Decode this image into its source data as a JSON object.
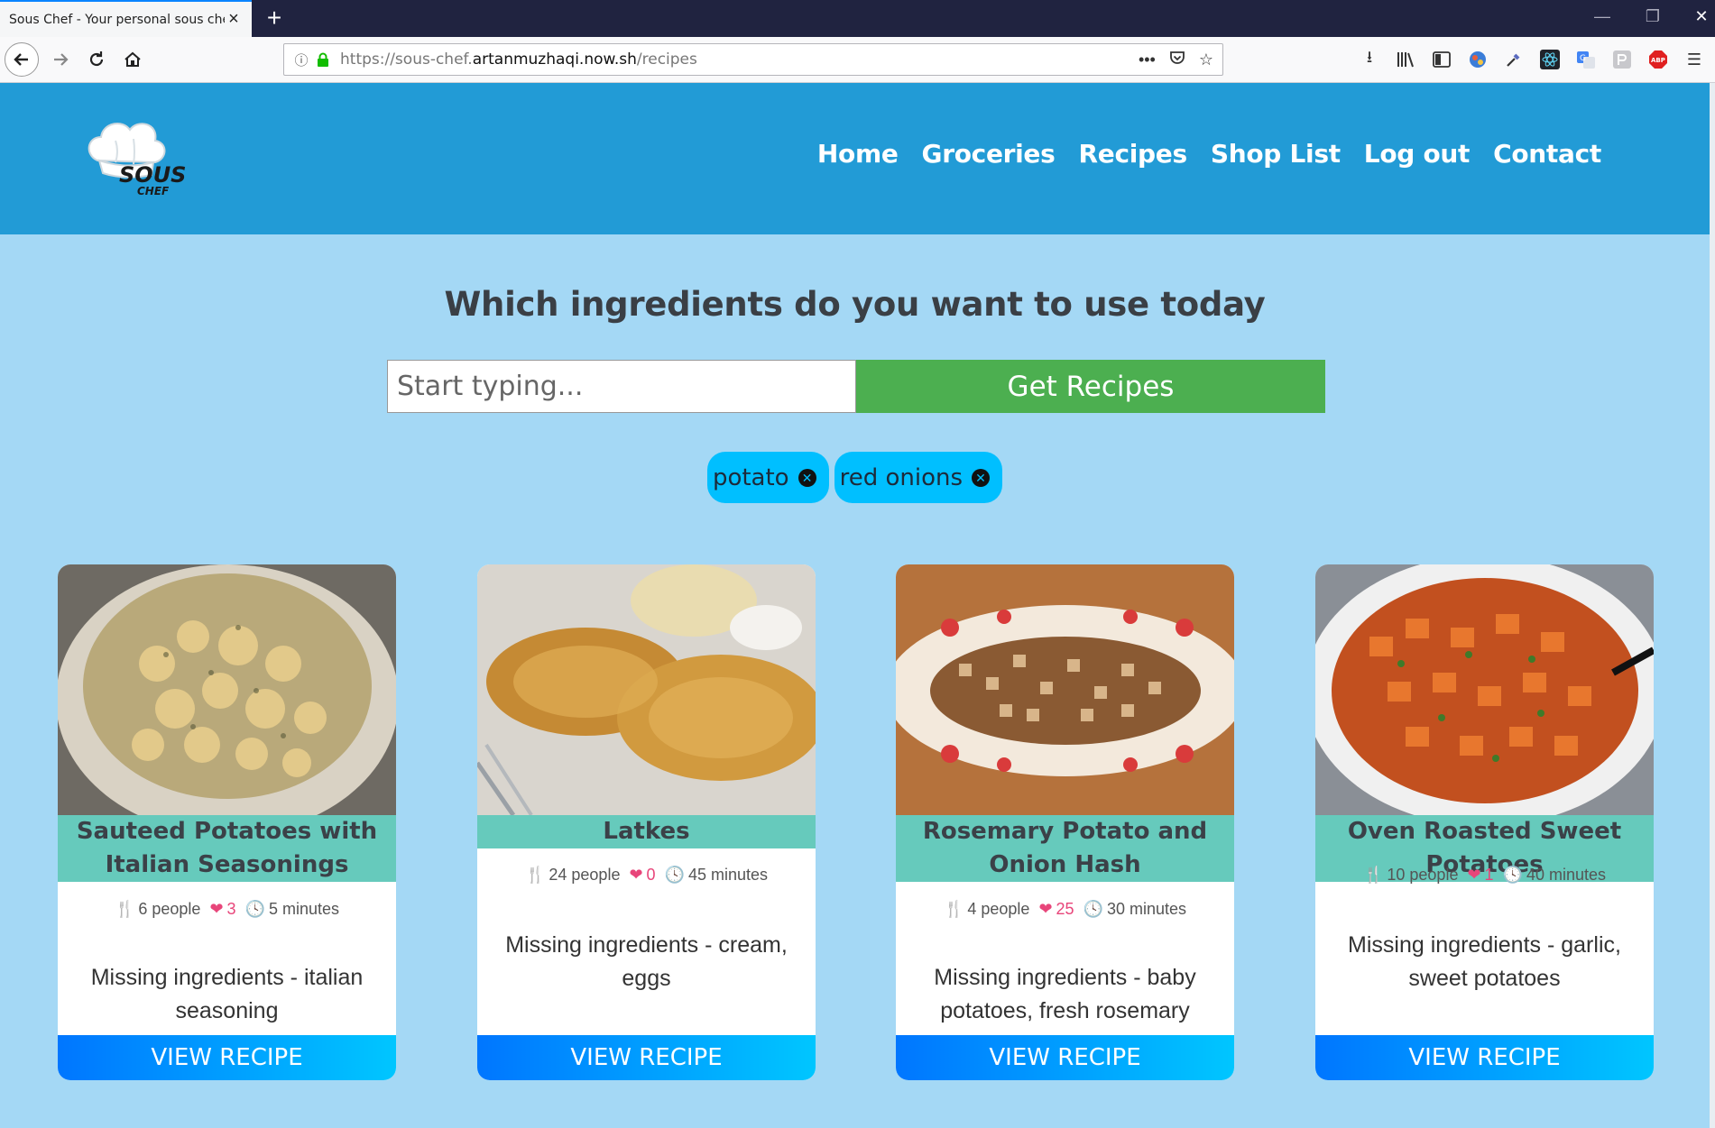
{
  "browser": {
    "tab_title": "Sous Chef - Your personal sous chef",
    "url_prefix": "https://sous-chef.",
    "url_domain": "artanmuzhaqi.now.sh",
    "url_path": "/recipes"
  },
  "site": {
    "logo_text": "SOUS",
    "logo_subtext": "CHEF",
    "nav": [
      "Home",
      "Groceries",
      "Recipes",
      "Shop List",
      "Log out",
      "Contact"
    ]
  },
  "search": {
    "heading": "Which ingredients do you want to use today",
    "placeholder": "Start typing...",
    "button_label": "Get Recipes",
    "chips": [
      "potato",
      "red onions"
    ]
  },
  "recipes": [
    {
      "title": "Sauteed Potatoes with Italian Seasonings",
      "people": "6 people",
      "likes": "3",
      "time": "5 minutes",
      "missing": "Missing ingredients - italian seasoning",
      "button": "VIEW RECIPE"
    },
    {
      "title": "Latkes",
      "people": "24 people",
      "likes": "0",
      "time": "45 minutes",
      "missing": "Missing ingredients - cream, eggs",
      "button": "VIEW RECIPE"
    },
    {
      "title": "Rosemary Potato and Onion Hash",
      "people": "4 people",
      "likes": "25",
      "time": "30 minutes",
      "missing": "Missing ingredients - baby potatoes, fresh rosemary",
      "button": "VIEW RECIPE"
    },
    {
      "title": "Oven Roasted Sweet Potatoes",
      "people": "10 people",
      "likes": "1",
      "time": "40 minutes",
      "missing": "Missing ingredients - garlic, sweet potatoes",
      "button": "VIEW RECIPE"
    }
  ],
  "colors": {
    "header": "#229bd6",
    "page_bg": "#a4d8f5",
    "get_button": "#4caf50",
    "chip": "#00bfff",
    "card_title_bg": "#66cabc",
    "heart": "#e8457a"
  }
}
